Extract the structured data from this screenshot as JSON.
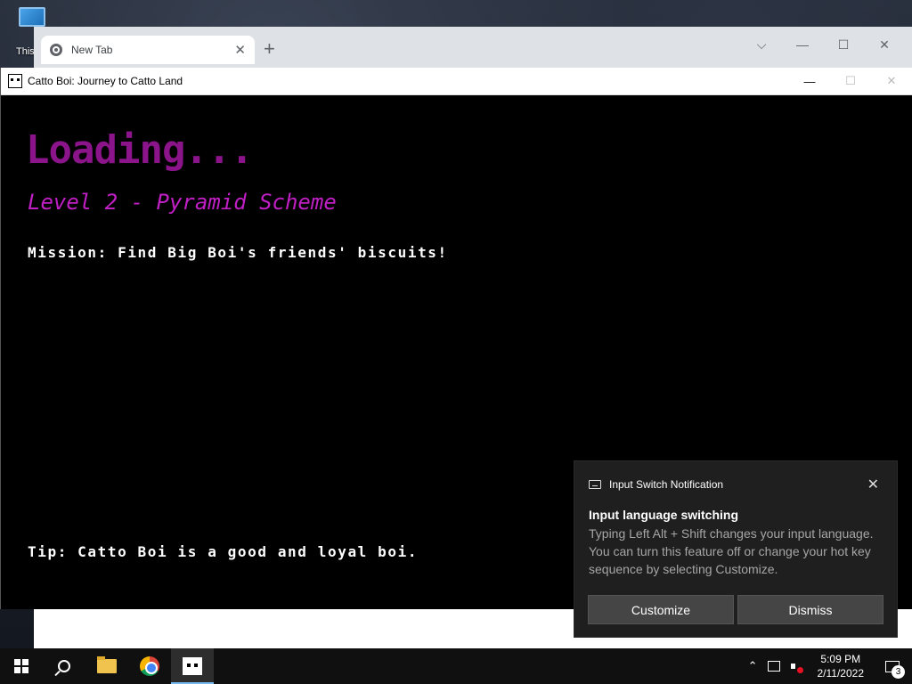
{
  "desktop": {
    "icon_label": "This"
  },
  "chrome": {
    "tab_title": "New Tab",
    "tab_close": "✕",
    "new_tab": "+",
    "controls": {
      "dropdown": "⌵",
      "minimize": "—",
      "maximize": "☐",
      "close": "✕"
    }
  },
  "game_window": {
    "title": "Catto Boi: Journey to Catto Land",
    "controls": {
      "minimize": "—",
      "maximize": "☐",
      "close": "✕"
    },
    "loading": "Loading...",
    "level": "Level 2 - Pyramid Scheme",
    "mission": "Mission: Find Big Boi's friends' biscuits!",
    "tip": "Tip: Catto Boi is a good and loyal boi.",
    "colors": {
      "loading": "#8b148b",
      "level": "#c01fc4",
      "background": "#000000"
    }
  },
  "toast": {
    "app_name": "Input Switch Notification",
    "close": "✕",
    "title": "Input language switching",
    "body": "Typing Left Alt + Shift changes your input language. You can turn this feature off or change your hot key sequence by selecting Customize.",
    "buttons": {
      "customize": "Customize",
      "dismiss": "Dismiss"
    }
  },
  "taskbar": {
    "items": [
      "start-icon",
      "search-icon",
      "file-explorer-icon",
      "chrome-icon",
      "catto-boi-icon"
    ],
    "active_item": "catto-boi-icon",
    "tray": {
      "chevron": "⌃",
      "time": "5:09 PM",
      "date": "2/11/2022",
      "notification_count": "3"
    }
  }
}
